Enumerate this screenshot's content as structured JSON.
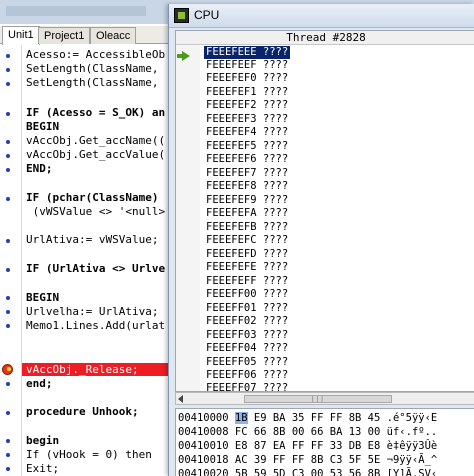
{
  "editor": {
    "tabs": [
      "Unit1",
      "Project1",
      "Oleacc"
    ],
    "code_lines": [
      "Acesso:= AccessibleOb",
      "SetLength(ClassName,",
      "SetLength(ClassName,",
      "",
      "IF (Acesso = S_OK) an",
      "BEGIN",
      "vAccObj.Get_accName((",
      "vAccObj.Get_accValue(",
      "END;",
      "",
      "IF (pchar(ClassName)",
      " (vWSValue <> '<null>'",
      "",
      "UrlAtiva:= vWSValue;",
      "",
      "IF (UrlAtiva <> Urlve",
      "",
      "BEGIN",
      "Urlvelha:= UrlAtiva;",
      "Memo1.Lines.Add(urlat",
      "",
      "",
      "end;",
      "",
      "procedure Unhook;",
      "",
      "begin",
      "If (vHook = 0) then",
      "Exit;"
    ],
    "highlight_line": "vAccObj._Release;"
  },
  "cpu": {
    "title": "CPU",
    "thread_header": "Thread #2828",
    "disasm_rows": [
      "FEEEFEEE ????",
      "FEEEFEEF ????",
      "FEEEFEF0 ????",
      "FEEEFEF1 ????",
      "FEEEFEF2 ????",
      "FEEEFEF3 ????",
      "FEEEFEF4 ????",
      "FEEEFEF5 ????",
      "FEEEFEF6 ????",
      "FEEEFEF7 ????",
      "FEEEFEF8 ????",
      "FEEEFEF9 ????",
      "FEEEFEFA ????",
      "FEEEFEFB ????",
      "FEEEFEFC ????",
      "FEEEFEFD ????",
      "FEEEFEFE ????",
      "FEEEFEFF ????",
      "FEEEFF00 ????",
      "FEEEFF01 ????",
      "FEEEFF02 ????",
      "FEEEFF03 ????",
      "FEEEFF04 ????",
      "FEEEFF05 ????",
      "FEEEFF06 ????",
      "FEEEFF07 ????"
    ],
    "hex_rows": [
      {
        "addr": "00410000",
        "first": "1B",
        "rest": "E9 BA 35 FF FF 8B 45",
        "ascii": ".é°5ÿÿ‹E"
      },
      {
        "addr": "00410008",
        "first": "FC",
        "rest": "66 8B 00 66 BA 13 00",
        "ascii": "üf‹.fº.."
      },
      {
        "addr": "00410010",
        "first": "E8",
        "rest": "87 EA FF FF 33 DB E8",
        "ascii": "è‡êÿÿ3Ûè"
      },
      {
        "addr": "00410018",
        "first": "AC",
        "rest": "39 FF FF 8B C3 5F 5E",
        "ascii": "¬9ÿÿ‹Ã_^"
      },
      {
        "addr": "00410020",
        "first": "5B",
        "rest": "59 5D C3 00 53 56 8B",
        "ascii": "[Y]Ã.SV‹"
      }
    ]
  }
}
